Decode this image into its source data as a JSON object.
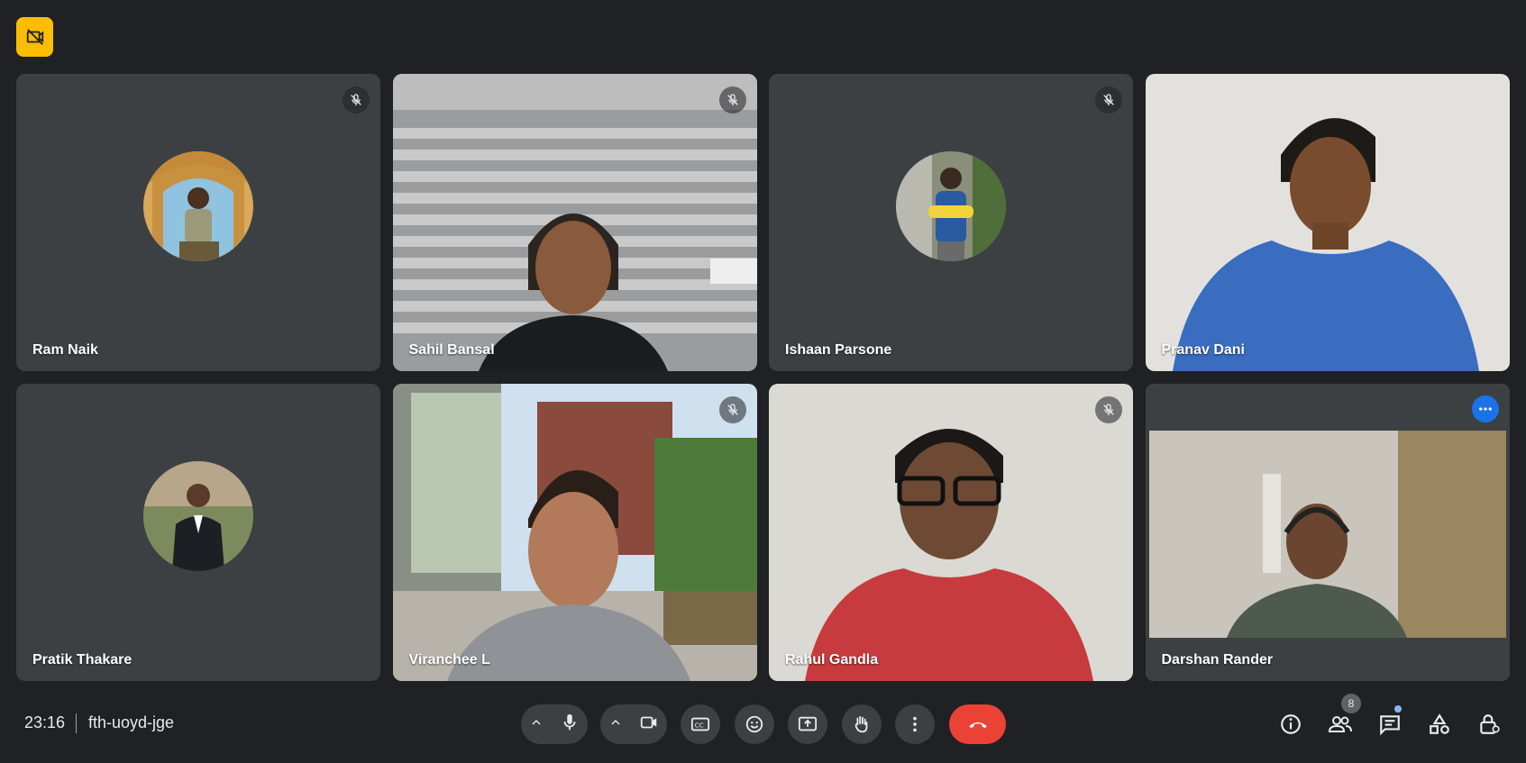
{
  "participants": [
    {
      "name": "Ram Naik",
      "muted": true,
      "video": false
    },
    {
      "name": "Sahil Bansal",
      "muted": true,
      "video": true
    },
    {
      "name": "Ishaan Parsone",
      "muted": true,
      "video": false
    },
    {
      "name": "Pranav Dani",
      "muted": false,
      "video": true
    },
    {
      "name": "Pratik Thakare",
      "muted": false,
      "video": false
    },
    {
      "name": "Viranchee L",
      "muted": true,
      "video": true
    },
    {
      "name": "Rahul Gandla",
      "muted": true,
      "video": true
    },
    {
      "name": "Darshan Rander",
      "muted": false,
      "video": true,
      "active": true
    }
  ],
  "meeting": {
    "time": "23:16",
    "code": "fth-uoyd-jge"
  },
  "people_count": "8",
  "colors": {
    "background": "#202124",
    "tile": "#3c4043",
    "accent": "#8ab4f8",
    "end_call": "#ea4335",
    "badge": "#fbbc04"
  },
  "icons": [
    "no-video-badge-icon",
    "mic-off-icon",
    "more-options-icon",
    "chevron-up-icon",
    "mic-icon",
    "camera-icon",
    "captions-icon",
    "emoji-icon",
    "present-icon",
    "raise-hand-icon",
    "more-vert-icon",
    "end-call-icon",
    "info-icon",
    "people-icon",
    "chat-icon",
    "activities-icon",
    "host-controls-icon"
  ]
}
